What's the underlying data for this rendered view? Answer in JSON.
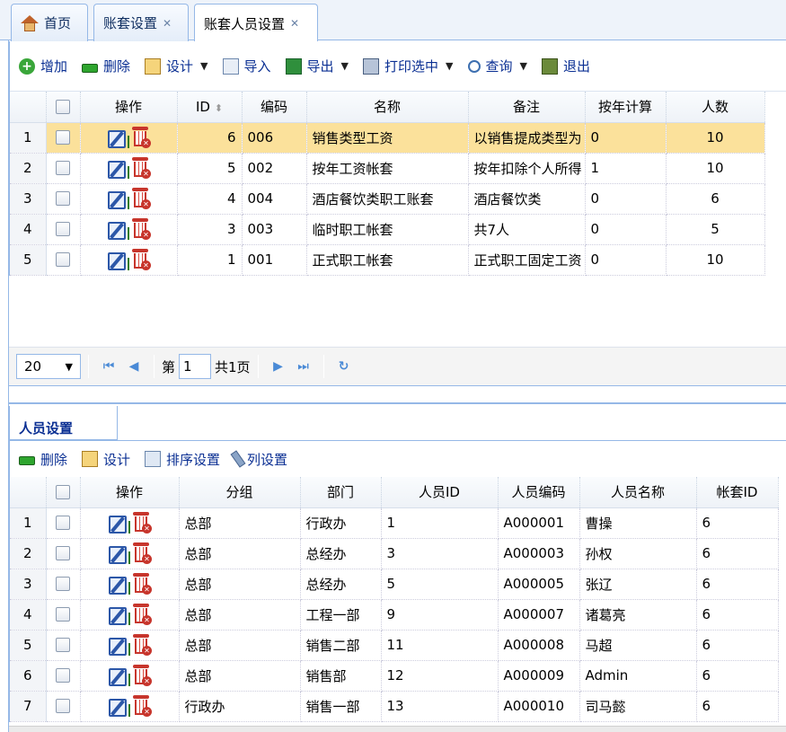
{
  "tabs": [
    {
      "label": "首页",
      "closable": false
    },
    {
      "label": "账套设置",
      "closable": true
    },
    {
      "label": "账套人员设置",
      "closable": true,
      "active": true
    }
  ],
  "top_toolbar": [
    {
      "label": "增加",
      "icon": "add-icon",
      "dropdown": false
    },
    {
      "label": "删除",
      "icon": "delete-icon",
      "dropdown": false
    },
    {
      "label": "设计",
      "icon": "design-icon",
      "dropdown": true
    },
    {
      "label": "导入",
      "icon": "import-icon",
      "dropdown": false
    },
    {
      "label": "导出",
      "icon": "export-icon",
      "dropdown": true
    },
    {
      "label": "打印选中",
      "icon": "print-icon",
      "dropdown": true
    },
    {
      "label": "查询",
      "icon": "search-icon",
      "dropdown": true
    },
    {
      "label": "退出",
      "icon": "exit-icon",
      "dropdown": false
    }
  ],
  "top_grid": {
    "columns": [
      "操作",
      "ID",
      "编码",
      "名称",
      "备注",
      "按年计算",
      "人数"
    ],
    "rows": [
      {
        "n": "1",
        "id": "6",
        "code": "006",
        "name": "销售类型工资",
        "note": "以销售提成类型为",
        "by_year": "0",
        "count": "10",
        "selected": true
      },
      {
        "n": "2",
        "id": "5",
        "code": "002",
        "name": "按年工资帐套",
        "note": "按年扣除个人所得",
        "by_year": "1",
        "count": "10"
      },
      {
        "n": "3",
        "id": "4",
        "code": "004",
        "name": "酒店餐饮类职工账套",
        "note": "酒店餐饮类",
        "by_year": "0",
        "count": "6"
      },
      {
        "n": "4",
        "id": "3",
        "code": "003",
        "name": "临时职工帐套",
        "note": "共7人",
        "by_year": "0",
        "count": "5"
      },
      {
        "n": "5",
        "id": "1",
        "code": "001",
        "name": "正式职工帐套",
        "note": "正式职工固定工资",
        "by_year": "0",
        "count": "10"
      }
    ]
  },
  "pager": {
    "page_size": "20",
    "page_prefix": "第",
    "page_value": "1",
    "page_total": "共1页"
  },
  "sub_tab": {
    "label": "人员设置"
  },
  "bottom_toolbar": [
    {
      "label": "删除",
      "icon": "delete-icon"
    },
    {
      "label": "设计",
      "icon": "design-icon"
    },
    {
      "label": "排序设置",
      "icon": "sort-icon"
    },
    {
      "label": "列设置",
      "icon": "wrench-icon"
    }
  ],
  "bottom_grid": {
    "columns": [
      "操作",
      "分组",
      "部门",
      "人员ID",
      "人员编码",
      "人员名称",
      "帐套ID"
    ],
    "rows": [
      {
        "n": "1",
        "group": "总部",
        "dept": "行政办",
        "pid": "1",
        "pcode": "A000001",
        "pname": "曹操",
        "aid": "6"
      },
      {
        "n": "2",
        "group": "总部",
        "dept": "总经办",
        "pid": "3",
        "pcode": "A000003",
        "pname": "孙权",
        "aid": "6"
      },
      {
        "n": "3",
        "group": "总部",
        "dept": "总经办",
        "pid": "5",
        "pcode": "A000005",
        "pname": "张辽",
        "aid": "6"
      },
      {
        "n": "4",
        "group": "总部",
        "dept": "工程一部",
        "pid": "9",
        "pcode": "A000007",
        "pname": "诸葛亮",
        "aid": "6"
      },
      {
        "n": "5",
        "group": "总部",
        "dept": "销售二部",
        "pid": "11",
        "pcode": "A000008",
        "pname": "马超",
        "aid": "6"
      },
      {
        "n": "6",
        "group": "总部",
        "dept": "销售部",
        "pid": "12",
        "pcode": "A000009",
        "pname": "Admin",
        "aid": "6"
      },
      {
        "n": "7",
        "group": "行政办",
        "dept": "销售一部",
        "pid": "13",
        "pcode": "A000010",
        "pname": "司马懿",
        "aid": "6"
      }
    ]
  }
}
